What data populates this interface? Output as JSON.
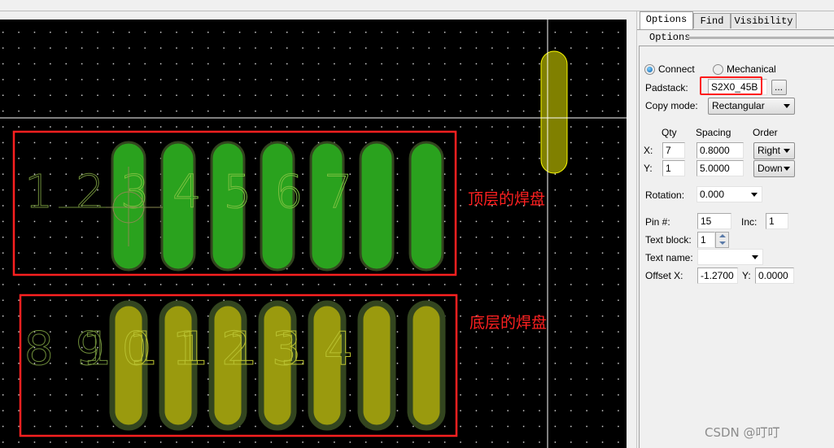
{
  "canvas": {
    "top_pad_labels": [
      "1",
      "2",
      "3",
      "4",
      "5",
      "6",
      "7"
    ],
    "bottom_pad_labels": [
      "8",
      "91",
      "01",
      "11",
      "21",
      "31",
      "4"
    ],
    "annotation_top": "顶层的焊盘",
    "annotation_bottom": "底层的焊盘",
    "colors": {
      "top_pad": "#2aa21e",
      "bottom_pad": "#9a9a0e",
      "outline": "#33451f",
      "highlight": "#ff2020",
      "selected_pad": "#808000"
    }
  },
  "panel": {
    "tabs": [
      {
        "label": "Options"
      },
      {
        "label": "Find"
      },
      {
        "label": "Visibility"
      }
    ],
    "group_title": "Options",
    "connect_label": "Connect",
    "mechanical_label": "Mechanical",
    "padstack_label": "Padstack:",
    "padstack_value": "S2X0_45B",
    "browse_label": "...",
    "copy_mode_label": "Copy mode:",
    "copy_mode_value": "Rectangular",
    "qty_header": "Qty",
    "spacing_header": "Spacing",
    "order_header": "Order",
    "x_label": "X:",
    "y_label": "Y:",
    "qty_x": "7",
    "qty_y": "1",
    "spacing_x": "0.8000",
    "spacing_y": "5.0000",
    "order_x": "Right",
    "order_y": "Down",
    "rotation_label": "Rotation:",
    "rotation_value": "0.000",
    "pin_label": "Pin #:",
    "pin_value": "15",
    "inc_label": "Inc:",
    "inc_value": "1",
    "text_block_label": "Text block:",
    "text_block_value": "1",
    "text_name_label": "Text name:",
    "text_name_value": "",
    "offset_x_label": "Offset X:",
    "offset_x_value": "-1.2700",
    "offset_y_label": "Y:",
    "offset_y_value": "0.0000"
  },
  "watermark": "CSDN @叮叮"
}
